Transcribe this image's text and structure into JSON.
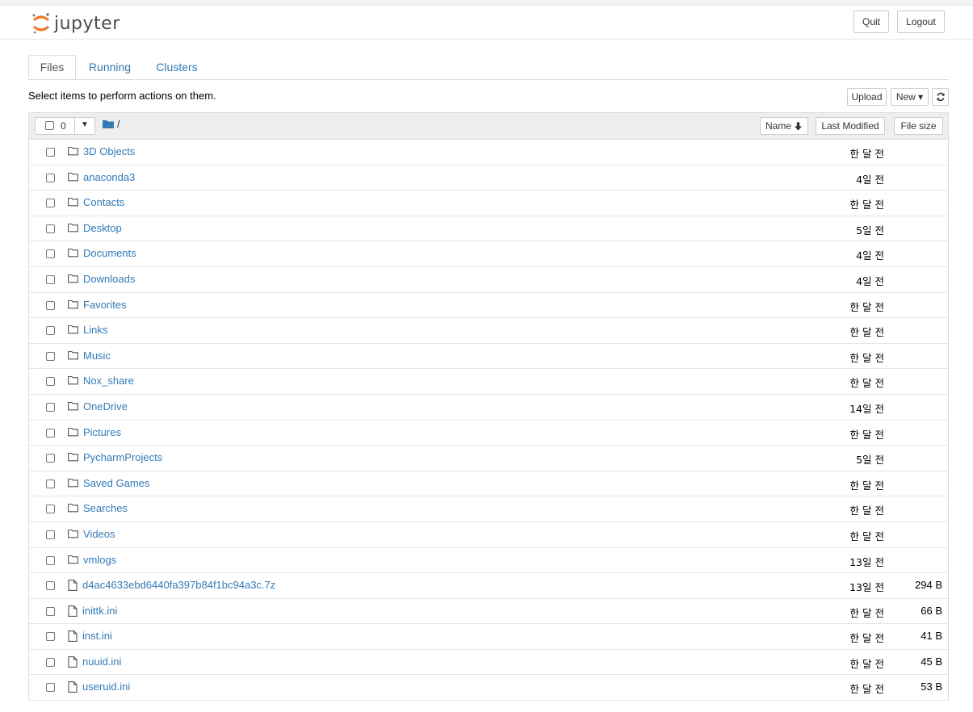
{
  "app": {
    "logo_text": "jupyter",
    "quit_label": "Quit",
    "logout_label": "Logout"
  },
  "tabs": [
    {
      "label": "Files"
    },
    {
      "label": "Running"
    },
    {
      "label": "Clusters"
    }
  ],
  "toolbar": {
    "hint": "Select items to perform actions on them.",
    "upload_label": "Upload",
    "new_label": "New ▾",
    "refresh_icon": "refresh-icon"
  },
  "list_header": {
    "selected_count": "0",
    "breadcrumb": "/",
    "sort_name_label": "Name",
    "sort_modified_label": "Last Modified",
    "sort_size_label": "File size"
  },
  "colors": {
    "link": "#337ab7",
    "header_bg": "#eeeeee",
    "border": "#dddddd"
  },
  "items": [
    {
      "name": "3D Objects",
      "type": "folder",
      "modified": "한 달 전",
      "size": ""
    },
    {
      "name": "anaconda3",
      "type": "folder",
      "modified": "4일 전",
      "size": ""
    },
    {
      "name": "Contacts",
      "type": "folder",
      "modified": "한 달 전",
      "size": ""
    },
    {
      "name": "Desktop",
      "type": "folder",
      "modified": "5일 전",
      "size": ""
    },
    {
      "name": "Documents",
      "type": "folder",
      "modified": "4일 전",
      "size": ""
    },
    {
      "name": "Downloads",
      "type": "folder",
      "modified": "4일 전",
      "size": ""
    },
    {
      "name": "Favorites",
      "type": "folder",
      "modified": "한 달 전",
      "size": ""
    },
    {
      "name": "Links",
      "type": "folder",
      "modified": "한 달 전",
      "size": ""
    },
    {
      "name": "Music",
      "type": "folder",
      "modified": "한 달 전",
      "size": ""
    },
    {
      "name": "Nox_share",
      "type": "folder",
      "modified": "한 달 전",
      "size": ""
    },
    {
      "name": "OneDrive",
      "type": "folder",
      "modified": "14일 전",
      "size": ""
    },
    {
      "name": "Pictures",
      "type": "folder",
      "modified": "한 달 전",
      "size": ""
    },
    {
      "name": "PycharmProjects",
      "type": "folder",
      "modified": "5일 전",
      "size": ""
    },
    {
      "name": "Saved Games",
      "type": "folder",
      "modified": "한 달 전",
      "size": ""
    },
    {
      "name": "Searches",
      "type": "folder",
      "modified": "한 달 전",
      "size": ""
    },
    {
      "name": "Videos",
      "type": "folder",
      "modified": "한 달 전",
      "size": ""
    },
    {
      "name": "vmlogs",
      "type": "folder",
      "modified": "13일 전",
      "size": ""
    },
    {
      "name": "d4ac4633ebd6440fa397b84f1bc94a3c.7z",
      "type": "file",
      "modified": "13일 전",
      "size": "294 B"
    },
    {
      "name": "inittk.ini",
      "type": "file",
      "modified": "한 달 전",
      "size": "66 B"
    },
    {
      "name": "inst.ini",
      "type": "file",
      "modified": "한 달 전",
      "size": "41 B"
    },
    {
      "name": "nuuid.ini",
      "type": "file",
      "modified": "한 달 전",
      "size": "45 B"
    },
    {
      "name": "useruid.ini",
      "type": "file",
      "modified": "한 달 전",
      "size": "53 B"
    }
  ]
}
